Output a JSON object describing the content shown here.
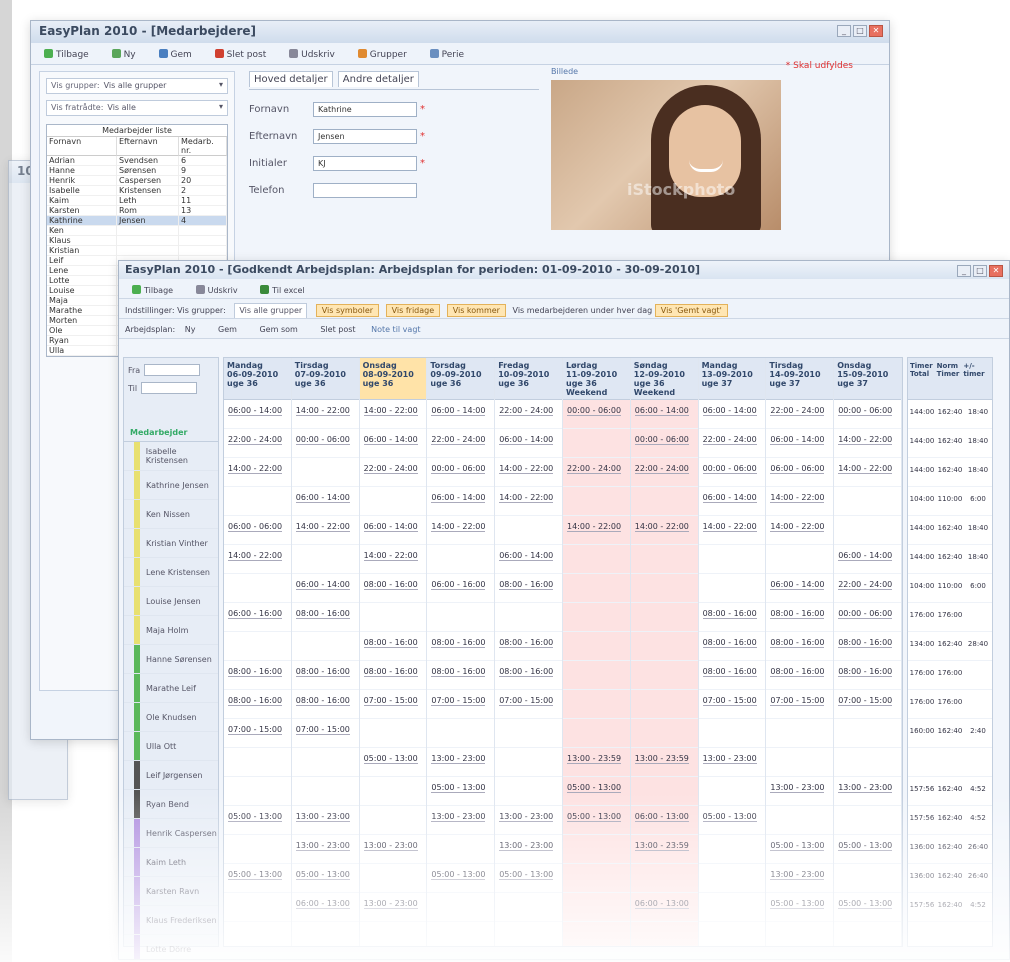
{
  "back_window": {
    "title": "10 -"
  },
  "employee_window": {
    "title": "EasyPlan 2010 - [Medarbejdere]",
    "toolbar": {
      "back": "Tilbage",
      "new": "Ny",
      "save": "Gem",
      "delete": "Slet post",
      "print": "Udskriv",
      "groups": "Grupper",
      "tasks": "Perie"
    },
    "close_link": "Skal udfyldes",
    "filters": [
      {
        "label": "Vis grupper:",
        "value": "Vis alle grupper"
      },
      {
        "label": "Vis fratrådte:",
        "value": "Vis alle"
      }
    ],
    "list": {
      "title": "Medarbejder liste",
      "columns": [
        "Fornavn",
        "Efternavn",
        "Medarb. nr."
      ],
      "rows": [
        [
          "Adrian",
          "Svendsen",
          "6"
        ],
        [
          "Hanne",
          "Sørensen",
          "9"
        ],
        [
          "Henrik",
          "Caspersen",
          "20"
        ],
        [
          "Isabelle",
          "Kristensen",
          "2"
        ],
        [
          "Kaim",
          "Leth",
          "11"
        ],
        [
          "Karsten",
          "Rom",
          "13"
        ],
        [
          "Kathrine",
          "Jensen",
          "4"
        ],
        [
          "Ken",
          "",
          ""
        ],
        [
          "Klaus",
          "",
          ""
        ],
        [
          "Kristian",
          "",
          ""
        ],
        [
          "Leif",
          "",
          ""
        ],
        [
          "Lene",
          "",
          ""
        ],
        [
          "Lotte",
          "",
          ""
        ],
        [
          "Louise",
          "",
          ""
        ],
        [
          "Maja",
          "",
          ""
        ],
        [
          "Marathe",
          "",
          ""
        ],
        [
          "Morten",
          "",
          ""
        ],
        [
          "Ole",
          "",
          ""
        ],
        [
          "Ryan",
          "",
          ""
        ],
        [
          "Ulla",
          "",
          ""
        ]
      ]
    },
    "tabs": [
      "Hoved detaljer",
      "Andre detaljer"
    ],
    "fields": [
      {
        "label": "Fornavn",
        "value": "Kathrine",
        "required": "*"
      },
      {
        "label": "Efternavn",
        "value": "Jensen",
        "required": "*"
      },
      {
        "label": "Initialer",
        "value": "KJ",
        "required": "*"
      },
      {
        "label": "Telefon",
        "value": "",
        "required": ""
      }
    ],
    "photo_label": "Billede",
    "photo_watermark": "iStockphoto"
  },
  "schedule_window": {
    "title": "EasyPlan 2010 - [Godkendt Arbejdsplan: Arbejdsplan for perioden: 01-09-2010 - 30-09-2010]",
    "toolbar": {
      "back": "Tilbage",
      "print": "Udskriv",
      "export": "Til excel"
    },
    "filter_row": {
      "settings": "Indstillinger:",
      "groups": "Vis grupper:",
      "group_value": "Vis alle grupper"
    },
    "pills": [
      "Vis symboler",
      "Vis fridage",
      "Vis kommer",
      "Vis 'Gemt vagt'"
    ],
    "pill_note": "Vis medarbejderen under hver dag",
    "plan_row": {
      "label": "Arbejdsplan:",
      "new": "Ny",
      "save": "Gem",
      "save_as": "Gem som",
      "delete": "Slet post",
      "notes": "Note til vagt"
    },
    "date_labels": {
      "from": "Fra",
      "to": "Til"
    },
    "employees_header": "Medarbejder",
    "employees": [
      {
        "name": "Isabelle Kristensen",
        "color": "#e8e070"
      },
      {
        "name": "Kathrine Jensen",
        "color": "#e8e070"
      },
      {
        "name": "Ken Nissen",
        "color": "#e8e070"
      },
      {
        "name": "Kristian Vinther",
        "color": "#e8e070"
      },
      {
        "name": "Lene Kristensen",
        "color": "#e8e070"
      },
      {
        "name": "Louise Jensen",
        "color": "#e8e070"
      },
      {
        "name": "Maja Holm",
        "color": "#e8e070"
      },
      {
        "name": "Hanne Sørensen",
        "color": "#5bb85b"
      },
      {
        "name": "Marathe Leif",
        "color": "#5bb85b"
      },
      {
        "name": "Ole Knudsen",
        "color": "#5bb85b"
      },
      {
        "name": "Ulla Ott",
        "color": "#5bb85b"
      },
      {
        "name": "Leif Jørgensen",
        "color": "#555555"
      },
      {
        "name": "Ryan Bend",
        "color": "#555555"
      },
      {
        "name": "Henrik Caspersen",
        "color": "#b090e0"
      },
      {
        "name": "Kaim Leth",
        "color": "#b090e0"
      },
      {
        "name": "Karsten Ravn",
        "color": "#b090e0"
      },
      {
        "name": "Klaus Frederiksen",
        "color": "#b090e0"
      },
      {
        "name": "Lotte Dörre",
        "color": "#b090e0"
      }
    ],
    "days": [
      {
        "head": "Mandag\n06-09-2010\nuge 36",
        "cells": [
          "06:00 - 14:00",
          "22:00 - 24:00",
          "14:00 - 22:00",
          "",
          "06:00 - 06:00",
          "14:00 - 22:00",
          "",
          "06:00 - 16:00",
          "",
          "08:00 - 16:00",
          "08:00 - 16:00",
          "07:00 - 15:00",
          "",
          "",
          "05:00 - 13:00",
          "",
          "05:00 - 13:00",
          ""
        ]
      },
      {
        "head": "Tirsdag\n07-09-2010\nuge 36",
        "cells": [
          "14:00 - 22:00",
          "00:00 - 06:00",
          "",
          "06:00 - 14:00",
          "14:00 - 22:00",
          "",
          "06:00 - 14:00",
          "08:00 - 16:00",
          "",
          "08:00 - 16:00",
          "08:00 - 16:00",
          "07:00 - 15:00",
          "",
          "",
          "13:00 - 23:00",
          "13:00 - 23:00",
          "05:00 - 13:00",
          "06:00 - 13:00"
        ]
      },
      {
        "head": "Onsdag\n08-09-2010\nuge 36",
        "cells": [
          "14:00 - 22:00",
          "06:00 - 14:00",
          "22:00 - 24:00",
          "",
          "06:00 - 14:00",
          "14:00 - 22:00",
          "08:00 - 16:00",
          "",
          "08:00 - 16:00",
          "08:00 - 16:00",
          "07:00 - 15:00",
          "",
          "05:00 - 13:00",
          "",
          "",
          "13:00 - 23:00",
          "",
          "13:00 - 23:00"
        ],
        "today": true
      },
      {
        "head": "Torsdag\n09-09-2010\nuge 36",
        "cells": [
          "06:00 - 14:00",
          "22:00 - 24:00",
          "00:00 - 06:00",
          "06:00 - 14:00",
          "14:00 - 22:00",
          "",
          "06:00 - 16:00",
          "",
          "08:00 - 16:00",
          "08:00 - 16:00",
          "07:00 - 15:00",
          "",
          "13:00 - 23:00",
          "05:00 - 13:00",
          "13:00 - 23:00",
          "",
          "05:00 - 13:00",
          ""
        ]
      },
      {
        "head": "Fredag\n10-09-2010\nuge 36",
        "cells": [
          "22:00 - 24:00",
          "06:00 - 14:00",
          "14:00 - 22:00",
          "14:00 - 22:00",
          "",
          "06:00 - 14:00",
          "08:00 - 16:00",
          "",
          "08:00 - 16:00",
          "08:00 - 16:00",
          "07:00 - 15:00",
          "",
          "",
          "",
          "13:00 - 23:00",
          "13:00 - 23:00",
          "05:00 - 13:00",
          ""
        ]
      },
      {
        "head": "Lørdag\n11-09-2010\nuge 36\nWeekend",
        "cells": [
          "00:00 - 06:00",
          "",
          "22:00 - 24:00",
          "",
          "14:00 - 22:00",
          "",
          "",
          "",
          "",
          "",
          "",
          "",
          "13:00 - 23:59",
          "05:00 - 13:00",
          "05:00 - 13:00",
          "",
          "",
          ""
        ],
        "weekend": true
      },
      {
        "head": "Søndag\n12-09-2010\nuge 36\nWeekend",
        "cells": [
          "06:00 - 14:00",
          "00:00 - 06:00",
          "22:00 - 24:00",
          "",
          "14:00 - 22:00",
          "",
          "",
          "",
          "",
          "",
          "",
          "",
          "13:00 - 23:59",
          "",
          "06:00 - 13:00",
          "13:00 - 23:59",
          "",
          "06:00 - 13:00"
        ],
        "weekend": true
      },
      {
        "head": "Mandag\n13-09-2010\nuge 37",
        "cells": [
          "06:00 - 14:00",
          "22:00 - 24:00",
          "00:00 - 06:00",
          "06:00 - 14:00",
          "14:00 - 22:00",
          "",
          "",
          "08:00 - 16:00",
          "08:00 - 16:00",
          "08:00 - 16:00",
          "07:00 - 15:00",
          "",
          "13:00 - 23:00",
          "",
          "05:00 - 13:00",
          "",
          "",
          ""
        ]
      },
      {
        "head": "Tirsdag\n14-09-2010\nuge 37",
        "cells": [
          "22:00 - 24:00",
          "06:00 - 14:00",
          "06:00 - 06:00",
          "14:00 - 22:00",
          "14:00 - 22:00",
          "",
          "06:00 - 14:00",
          "08:00 - 16:00",
          "08:00 - 16:00",
          "08:00 - 16:00",
          "07:00 - 15:00",
          "",
          "",
          "13:00 - 23:00",
          "",
          "05:00 - 13:00",
          "13:00 - 23:00",
          "05:00 - 13:00"
        ]
      },
      {
        "head": "Onsdag\n15-09-2010\nuge 37",
        "cells": [
          "00:00 - 06:00",
          "14:00 - 22:00",
          "14:00 - 22:00",
          "",
          "",
          "06:00 - 14:00",
          "22:00 - 24:00",
          "00:00 - 06:00",
          "08:00 - 16:00",
          "08:00 - 16:00",
          "07:00 - 15:00",
          "",
          "",
          "13:00 - 23:00",
          "",
          "05:00 - 13:00",
          "",
          "05:00 - 13:00"
        ]
      }
    ],
    "totals_head": [
      "Timer Total",
      "Norm Timer",
      "+/- timer"
    ],
    "totals": [
      [
        "144:00",
        "162:40",
        "18:40"
      ],
      [
        "144:00",
        "162:40",
        "18:40"
      ],
      [
        "144:00",
        "162:40",
        "18:40"
      ],
      [
        "104:00",
        "110:00",
        "6:00"
      ],
      [
        "144:00",
        "162:40",
        "18:40"
      ],
      [
        "144:00",
        "162:40",
        "18:40"
      ],
      [
        "104:00",
        "110:00",
        "6:00"
      ],
      [
        "176:00",
        "176:00",
        ""
      ],
      [
        "134:00",
        "162:40",
        "28:40"
      ],
      [
        "176:00",
        "176:00",
        ""
      ],
      [
        "176:00",
        "176:00",
        ""
      ],
      [
        "160:00",
        "162:40",
        "2:40"
      ],
      [
        "",
        "",
        ""
      ],
      [
        "157:56",
        "162:40",
        "4:52"
      ],
      [
        "157:56",
        "162:40",
        "4:52"
      ],
      [
        "136:00",
        "162:40",
        "26:40"
      ],
      [
        "136:00",
        "162:40",
        "26:40"
      ],
      [
        "157:56",
        "162:40",
        "4:52"
      ]
    ]
  }
}
